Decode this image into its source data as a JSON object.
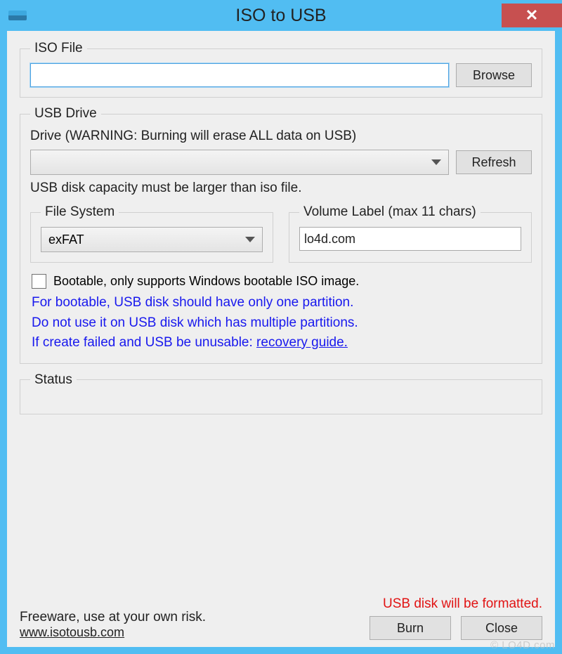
{
  "window": {
    "title": "ISO to USB"
  },
  "iso": {
    "legend": "ISO File",
    "value": "",
    "browse": "Browse"
  },
  "usb": {
    "legend": "USB Drive",
    "drive_label": "Drive (WARNING: Burning will erase ALL data on USB)",
    "refresh": "Refresh",
    "capacity_note": "USB disk capacity must be larger than iso file.",
    "fs": {
      "legend": "File System",
      "value": "exFAT"
    },
    "vol": {
      "legend": "Volume Label (max 11 chars)",
      "value": "lo4d.com"
    },
    "bootable_label": "Bootable, only supports Windows bootable ISO image.",
    "hint1": "For bootable, USB disk should have only one partition.",
    "hint2": "Do not use it on USB disk which has multiple partitions.",
    "hint3a": "If create failed and USB be unusable: ",
    "hint3b": "recovery guide."
  },
  "status": {
    "legend": "Status"
  },
  "footer": {
    "freeware": "Freeware, use at your own risk.",
    "site": "www.isotousb.com",
    "warn": "USB disk will be formatted.",
    "burn": "Burn",
    "close": "Close"
  },
  "watermark": "© LO4D.com"
}
